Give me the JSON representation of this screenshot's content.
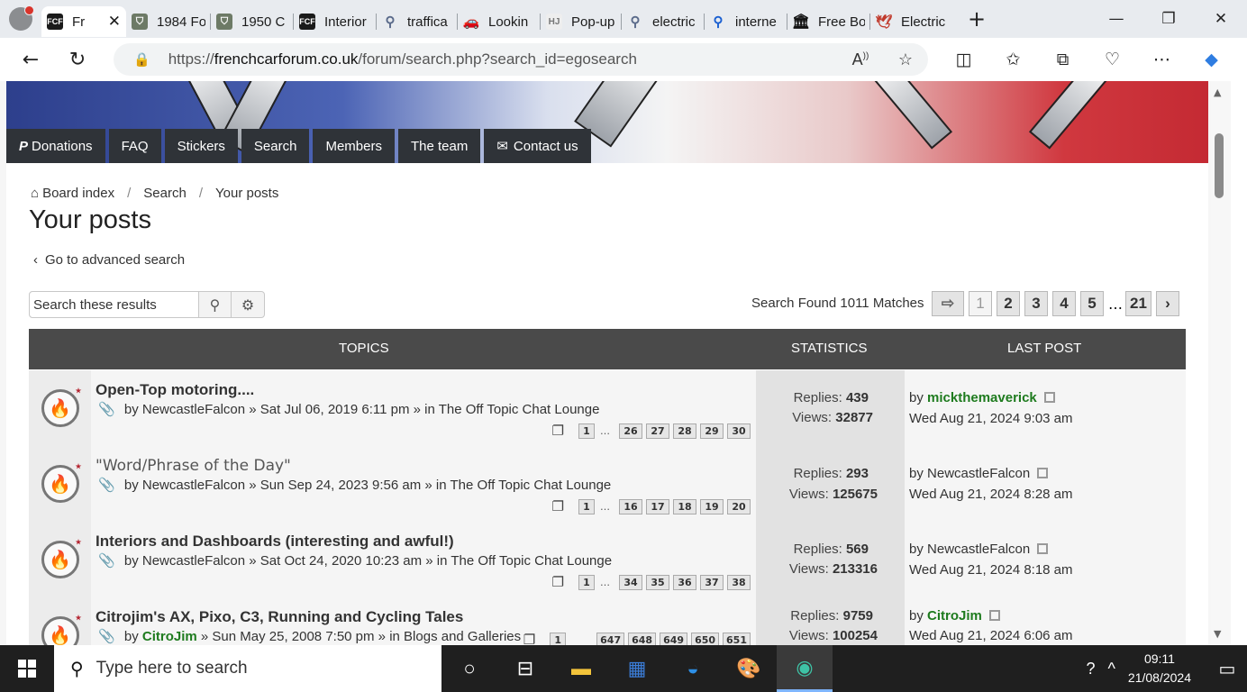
{
  "browser": {
    "tabs": [
      {
        "label": "Fr",
        "favicon": "FCF",
        "active": true
      },
      {
        "label": "1984 Fo",
        "favicon": "shield"
      },
      {
        "label": "1950 C",
        "favicon": "shield"
      },
      {
        "label": "Interior",
        "favicon": "FCF"
      },
      {
        "label": "traffica",
        "favicon": "search"
      },
      {
        "label": "Lookin",
        "favicon": "car"
      },
      {
        "label": "Pop-up",
        "favicon": "HJ"
      },
      {
        "label": "electric",
        "favicon": "search"
      },
      {
        "label": "interne",
        "favicon": "search"
      },
      {
        "label": "Free Bo",
        "favicon": "building"
      },
      {
        "label": "Electric",
        "favicon": "bird"
      }
    ],
    "close_tab": "✕",
    "new_tab": "+",
    "url_prefix": "https://",
    "url_domain": "frenchcarforum.co.uk",
    "url_path": "/forum/search.php?search_id=egosearch"
  },
  "forum": {
    "nav": [
      "Donations",
      "FAQ",
      "Stickers",
      "Search",
      "Members",
      "The team",
      "Contact us"
    ],
    "breadcrumbs": [
      "Board index",
      "Search",
      "Your posts"
    ],
    "title": "Your posts",
    "advanced_link": "Go to advanced search",
    "search_placeholder": "Search these results",
    "found": "Search Found 1011 Matches",
    "pages": [
      "1",
      "2",
      "3",
      "4",
      "5",
      "…",
      "21"
    ],
    "headers": {
      "topics": "TOPICS",
      "statistics": "STATISTICS",
      "last_post": "LAST POST"
    },
    "topics": [
      {
        "title": "Open-Top motoring....",
        "by": "by",
        "author": "NewcastleFalcon",
        "date": "» Sat Jul 06, 2019 6:11 pm » in",
        "forum": "The Off Topic Chat Lounge",
        "pages": [
          "1",
          "…",
          "26",
          "27",
          "28",
          "29",
          "30"
        ],
        "replies_label": "Replies:",
        "replies": "439",
        "views_label": "Views:",
        "views": "32877",
        "last_by": "by",
        "last_author": "mickthemaverick",
        "last_date": "Wed Aug 21, 2024 9:03 am"
      },
      {
        "title": "\"Word/Phrase of the Day\"",
        "by": "by",
        "author": "NewcastleFalcon",
        "date": "» Sun Sep 24, 2023 9:56 am » in",
        "forum": "The Off Topic Chat Lounge",
        "pages": [
          "1",
          "…",
          "16",
          "17",
          "18",
          "19",
          "20"
        ],
        "replies_label": "Replies:",
        "replies": "293",
        "views_label": "Views:",
        "views": "125675",
        "last_by": "by",
        "last_author": "NewcastleFalcon",
        "last_date": "Wed Aug 21, 2024 8:28 am"
      },
      {
        "title": "Interiors and Dashboards (interesting and awful!)",
        "by": "by",
        "author": "NewcastleFalcon",
        "date": "» Sat Oct 24, 2020 10:23 am » in",
        "forum": "The Off Topic Chat Lounge",
        "pages": [
          "1",
          "…",
          "34",
          "35",
          "36",
          "37",
          "38"
        ],
        "replies_label": "Replies:",
        "replies": "569",
        "views_label": "Views:",
        "views": "213316",
        "last_by": "by",
        "last_author": "NewcastleFalcon",
        "last_date": "Wed Aug 21, 2024 8:18 am"
      },
      {
        "title": "Citrojim's AX, Pixo, C3, Running and Cycling Tales",
        "by": "by",
        "author": "CitroJim",
        "date": "» Sun May 25, 2008 7:50 pm » in",
        "forum": "Blogs and Galleries",
        "pages": [
          "1",
          "647",
          "648",
          "649",
          "650",
          "651"
        ],
        "replies_label": "Replies:",
        "replies": "9759",
        "views_label": "Views:",
        "views": "100254",
        "last_by": "by",
        "last_author": "CitroJim",
        "last_date": "Wed Aug 21, 2024 6:06 am"
      }
    ]
  },
  "taskbar": {
    "search_placeholder": "Type here to search",
    "time": "09:11",
    "date": "21/08/2024"
  }
}
